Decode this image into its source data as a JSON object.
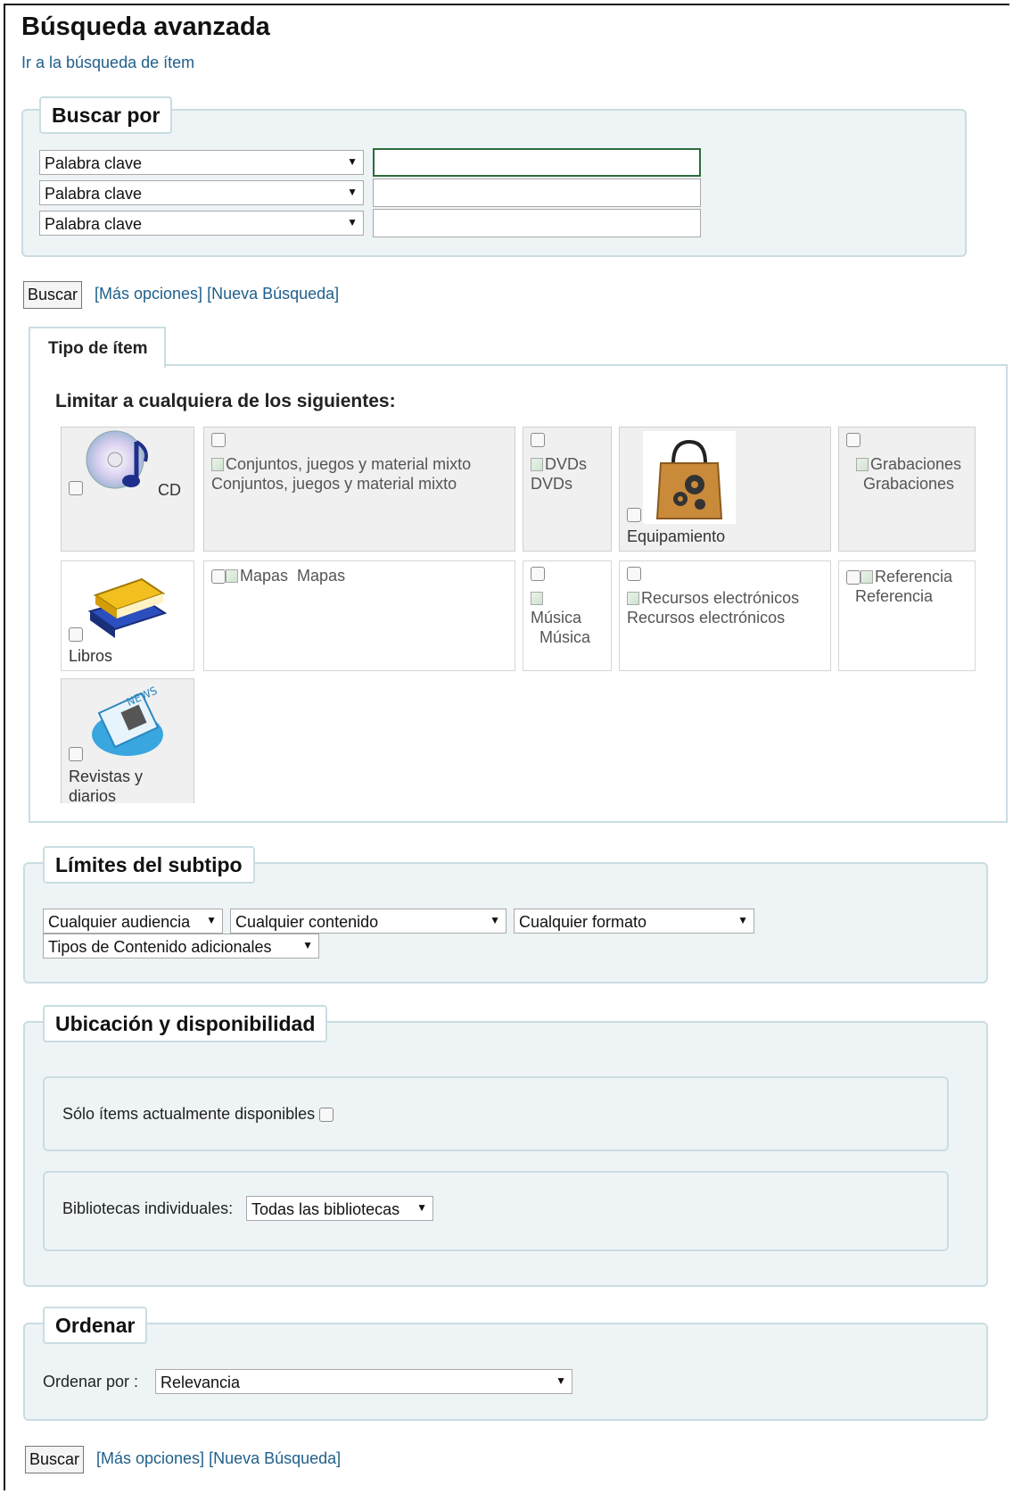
{
  "header": {
    "title": "Búsqueda avanzada",
    "item_search_link": "Ir a la búsqueda de ítem"
  },
  "search_by": {
    "legend": "Buscar por",
    "rows": [
      {
        "index": "Palabra clave",
        "value": ""
      },
      {
        "index": "Palabra clave",
        "value": ""
      },
      {
        "index": "Palabra clave",
        "value": ""
      }
    ]
  },
  "actions": {
    "search_button": "Buscar",
    "more_options": "[Más opciones]",
    "new_search": "[Nueva Búsqueda]"
  },
  "item_type": {
    "tab_label": "Tipo de ítem",
    "heading": "Limitar a cualquiera de los siguientes:",
    "types": [
      {
        "label": "CD",
        "icon": "cd-music-icon"
      },
      {
        "label": "Conjuntos, juegos y material mixto",
        "alt": "Conjuntos, juegos y material mixto",
        "icon": "broken-image-icon"
      },
      {
        "label": "DVDs",
        "alt": "DVDs",
        "icon": "broken-image-icon"
      },
      {
        "label": "Equipamiento",
        "icon": "equipment-bag-icon"
      },
      {
        "label": "Grabaciones",
        "alt": "Grabaciones",
        "icon": "broken-image-icon"
      },
      {
        "label": "Libros",
        "icon": "books-icon"
      },
      {
        "label": "Mapas",
        "alt": "Mapas",
        "icon": "broken-image-icon"
      },
      {
        "label": "Música",
        "alt": "Música",
        "icon": "broken-image-icon"
      },
      {
        "label": "Recursos electrónicos",
        "alt": "Recursos electrónicos",
        "icon": "broken-image-icon"
      },
      {
        "label": "Referencia",
        "alt": "Referencia",
        "icon": "broken-image-icon"
      },
      {
        "label": "Revistas y diarios",
        "label_line1": "Revistas y",
        "label_line2": "diarios",
        "icon": "news-magazines-icon"
      }
    ]
  },
  "subtype": {
    "legend": "Límites del subtipo",
    "audience": "Cualquier audiencia",
    "content": "Cualquier contenido",
    "format": "Cualquier formato",
    "additional": "Tipos de Contenido adicionales"
  },
  "location": {
    "legend": "Ubicación y disponibilidad",
    "available_only": "Sólo ítems actualmente disponibles",
    "libraries_label": "Bibliotecas individuales:",
    "libraries_value": "Todas las bibliotecas"
  },
  "sort": {
    "legend": "Ordenar",
    "label": "Ordenar por :",
    "value": "Relevancia"
  },
  "colors": {
    "link": "#1f5f8b",
    "box_bg": "#eef4f6",
    "box_border": "#c9dde2"
  }
}
